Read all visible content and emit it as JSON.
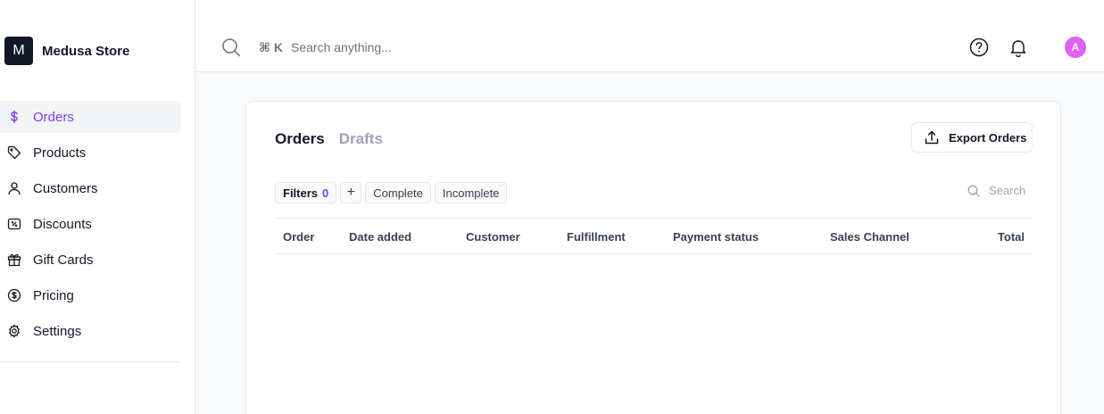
{
  "store": {
    "logo_letter": "M",
    "name": "Medusa Store"
  },
  "sidebar": {
    "items": [
      {
        "label": "Orders",
        "icon": "dollar-icon",
        "active": true
      },
      {
        "label": "Products",
        "icon": "tag-icon"
      },
      {
        "label": "Customers",
        "icon": "user-icon"
      },
      {
        "label": "Discounts",
        "icon": "discount-icon"
      },
      {
        "label": "Gift Cards",
        "icon": "gift-icon"
      },
      {
        "label": "Pricing",
        "icon": "coin-icon"
      },
      {
        "label": "Settings",
        "icon": "gear-icon"
      }
    ]
  },
  "topbar": {
    "shortcut": "⌘ K",
    "search_placeholder": "Search anything...",
    "avatar_letter": "A"
  },
  "orders": {
    "tabs": [
      "Orders",
      "Drafts"
    ],
    "export_label": "Export Orders",
    "filters": {
      "label": "Filters",
      "count": "0",
      "presets": [
        "Complete",
        "Incomplete"
      ],
      "add": "+"
    },
    "search_placeholder": "Search",
    "columns": [
      "Order",
      "Date added",
      "Customer",
      "Fulfillment",
      "Payment status",
      "Sales Channel",
      "Total"
    ]
  },
  "colors": {
    "accent": "#7c3aed",
    "avatar": "#d946ef"
  }
}
